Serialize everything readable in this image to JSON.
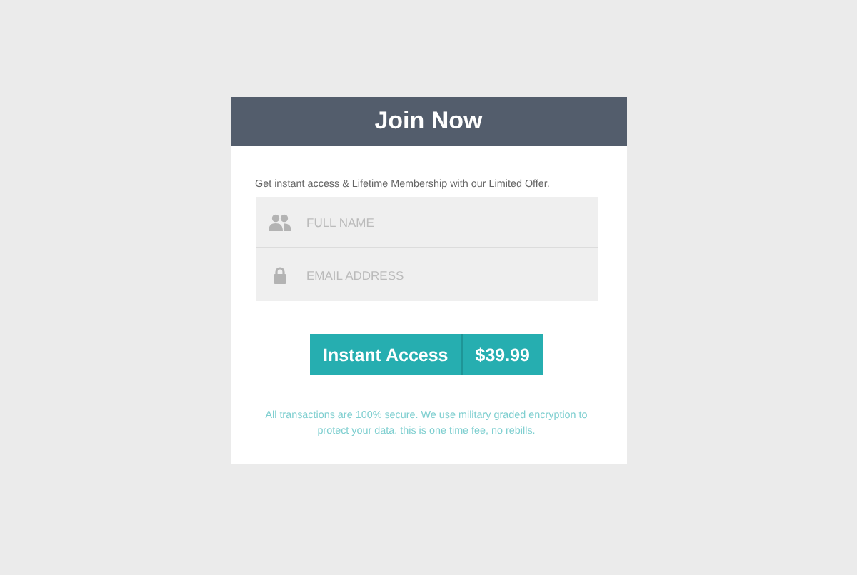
{
  "header": {
    "title": "Join Now"
  },
  "intro": "Get instant access & Lifetime Membership with our Limited Offer.",
  "fields": [
    {
      "kind": "person",
      "placeholder": "FULL NAME"
    },
    {
      "kind": "lock",
      "placeholder": "EMAIL ADDRESS"
    }
  ],
  "button": {
    "label": "Instant Access",
    "price": "$39.99"
  },
  "note": "All transactions are 100% secure. We use military graded encryption to protect your data. this is one time fee, no rebills."
}
